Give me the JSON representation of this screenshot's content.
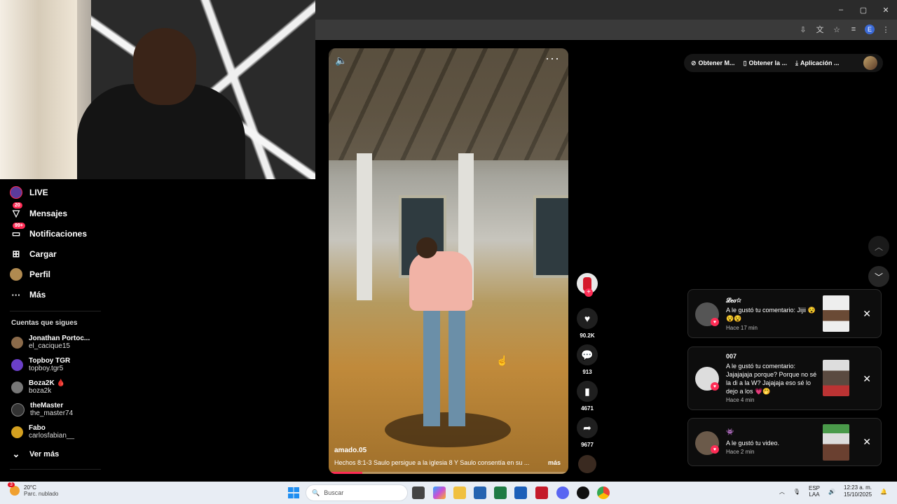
{
  "browser": {
    "win_minimize": "–",
    "win_maximize": "▢",
    "win_close": "✕",
    "profile_initial": "E"
  },
  "sidebar": {
    "items": [
      {
        "label": "LIVE"
      },
      {
        "label": "Mensajes",
        "badge": "20"
      },
      {
        "label": "Notificaciones",
        "badge": "99+"
      },
      {
        "label": "Cargar"
      },
      {
        "label": "Perfil"
      },
      {
        "label": "Más"
      }
    ],
    "following_title": "Cuentas que sigues",
    "following": [
      {
        "name": "Jonathan Portoc...",
        "handle": "el_cacique15",
        "color": "#8a6a4a"
      },
      {
        "name": "Topboy TGR",
        "handle": "topboy.tgr5",
        "color": "#6a3fc7"
      },
      {
        "name": "Boza2K 🩸",
        "handle": "boza2k",
        "color": "#777777"
      },
      {
        "name": "theMaster",
        "handle": "the_master74",
        "color": "#333333"
      },
      {
        "name": "Fabo",
        "handle": "carlosfabian__",
        "color": "#d4a020"
      }
    ],
    "see_more": "Ver más"
  },
  "video": {
    "author": "amado.05",
    "caption": "Hechos 8:1-3 Saulo persigue a la iglesia 8 Y Saulo consentía en su ...",
    "more_label": "más",
    "progress": 0.14
  },
  "actions": {
    "likes": "90.2K",
    "comments": "913",
    "saves": "4671",
    "shares": "9677"
  },
  "header": {
    "pills": [
      {
        "icon": "⊘",
        "label": "Obtener M..."
      },
      {
        "icon": "▯",
        "label": "Obtener la ..."
      },
      {
        "icon": "⤓",
        "label": "Aplicación ..."
      }
    ]
  },
  "notifications": [
    {
      "title": "𝓛𝒆𝒐☆",
      "message": "A le gustó tu comentario: Jijii 😵😵😵",
      "time": "Hace 17 min",
      "avatar": "#555555"
    },
    {
      "title": "007",
      "message": "A le gustó tu comentario: Jajajajaja porque? Porque no sé la di a la W? Jajajaja eso sé lo dejo a los 💗🤭",
      "time": "Hace 4 min",
      "avatar": "#dddddd"
    },
    {
      "title": "👾",
      "message": "A le gustó tu video.",
      "time": "Hace 2 min",
      "avatar": "#6b5a4a"
    }
  ],
  "taskbar": {
    "temperature": "20°C",
    "weather": "Parc. nublado",
    "weather_badge": "3",
    "search_placeholder": "Buscar",
    "lang1": "ESP",
    "lang2": "LAA",
    "time": "12:23 a. m.",
    "date": "15/10/2025"
  },
  "colors": {
    "accent": "#fe2c55",
    "taskbar": "#e8edf4"
  }
}
